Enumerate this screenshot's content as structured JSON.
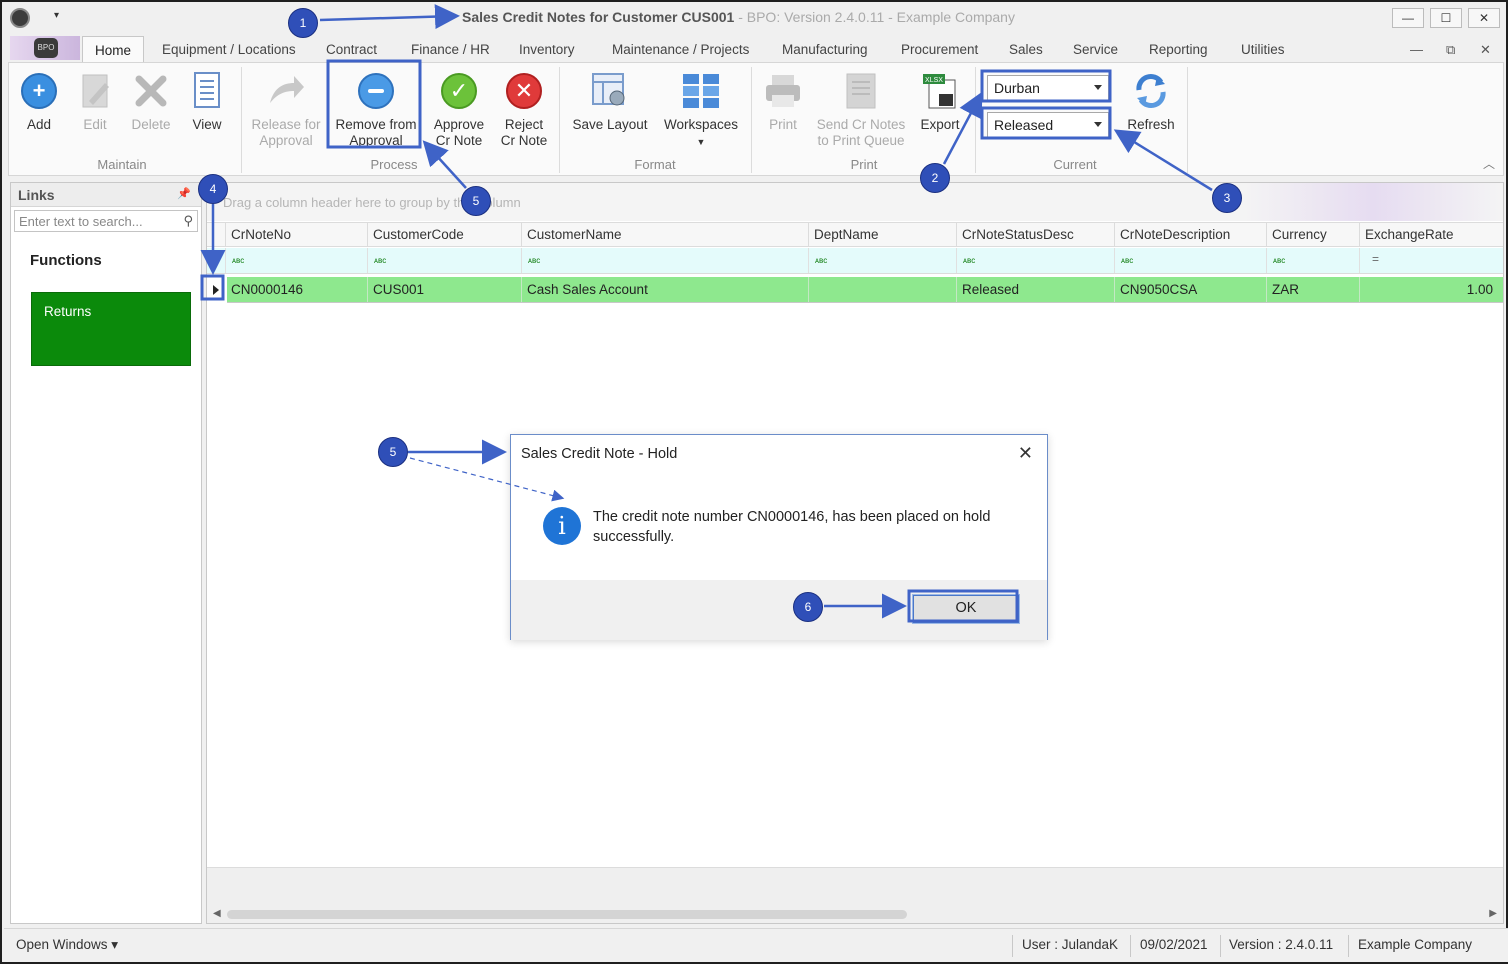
{
  "titlebar": {
    "title_strong": "Sales Credit Notes for Customer CUS001",
    "title_rest": " - BPO: Version 2.4.0.11 - Example Company",
    "qa_menu": "▾",
    "app_logo_text": "BPO",
    "buttons": [
      "—",
      "☐",
      "✕"
    ]
  },
  "tabs": {
    "items": [
      "Home",
      "Equipment / Locations",
      "Contract",
      "Finance / HR",
      "Inventory",
      "Maintenance / Projects",
      "Manufacturing",
      "Procurement",
      "Sales",
      "Service",
      "Reporting",
      "Utilities"
    ],
    "active": "Home",
    "mdi_controls": [
      "—",
      "⧉",
      "✕"
    ]
  },
  "ribbon": {
    "groups": {
      "maintain": "Maintain",
      "process": "Process",
      "format": "Format",
      "print": "Print",
      "current": "Current"
    },
    "buttons": {
      "add": "Add",
      "edit": "Edit",
      "delete": "Delete",
      "view": "View",
      "release_1": "Release for",
      "release_2": "Approval",
      "remove_1": "Remove from",
      "remove_2": "Approval",
      "approve_1": "Approve",
      "approve_2": "Cr Note",
      "reject_1": "Reject",
      "reject_2": "Cr Note",
      "save_layout": "Save Layout",
      "workspaces": "Workspaces",
      "print": "Print",
      "send_1": "Send Cr Notes",
      "send_2": "to Print Queue",
      "export": "Export",
      "refresh": "Refresh"
    },
    "export_badge": "XLSX",
    "site_combo": "Durban",
    "status_combo": "Released",
    "collapse_glyph": "︿"
  },
  "links": {
    "header": "Links",
    "pin": "📌",
    "search_placeholder": "Enter text to search...",
    "search_icon": "⚲",
    "functions_title": "Functions",
    "tiles": [
      "Returns"
    ]
  },
  "grid": {
    "group_panel_text": "Drag a column header here to group by that column",
    "columns": [
      "CrNoteNo",
      "CustomerCode",
      "CustomerName",
      "DeptName",
      "CrNoteStatusDesc",
      "CrNoteDescription",
      "Currency",
      "ExchangeRate"
    ],
    "filter_glyph": "ᴀʙc",
    "filter_eq": "=",
    "rows": [
      {
        "CrNoteNo": "CN0000146",
        "CustomerCode": "CUS001",
        "CustomerName": "Cash Sales Account",
        "DeptName": "",
        "CrNoteStatusDesc": "Released",
        "CrNoteDescription": "CN9050CSA",
        "Currency": "ZAR",
        "ExchangeRate": "1.00"
      }
    ]
  },
  "dialog": {
    "title": "Sales Credit Note - Hold",
    "close": "✕",
    "icon": "i",
    "message": "The credit note number CN0000146, has been placed on hold successfully.",
    "ok": "OK"
  },
  "statusbar": {
    "open_windows": "Open Windows ▾",
    "user": "User : JulandaK",
    "date": "09/02/2021",
    "version": "Version : 2.4.0.11",
    "company": "Example Company"
  },
  "annotations": {
    "badges": [
      "1",
      "2",
      "3",
      "4",
      "5",
      "5",
      "6"
    ],
    "color": "#3f63c7"
  },
  "colors": {
    "row_highlight": "#8ee88e",
    "tile_green": "#0b8a0b",
    "annotation_blue": "#2f4fb8",
    "filter_row": "#e4fbfb"
  }
}
